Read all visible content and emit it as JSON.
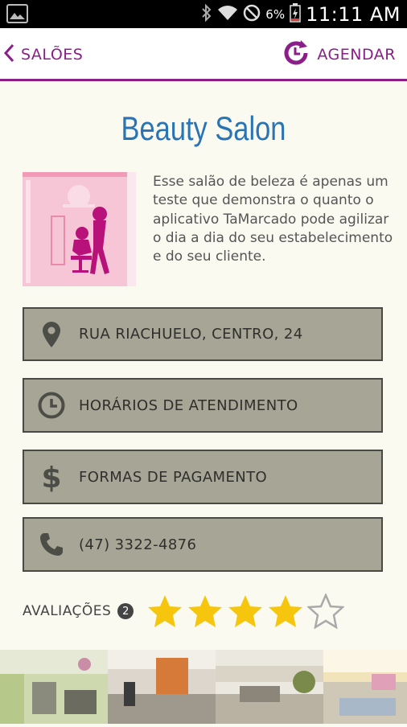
{
  "status_bar": {
    "battery_percent": "6%",
    "time": "11:11 AM"
  },
  "action_bar": {
    "back_label": "SALÕES",
    "agendar_label": "AGENDAR",
    "accent_color": "#8a1f8a"
  },
  "salon": {
    "name": "Beauty Salon",
    "description": "Esse salão de beleza é apenas um teste que demonstra o quanto o aplicativo TaMarcado pode agilizar o dia a dia do seu estabelecimento e do seu cliente."
  },
  "info": {
    "address": "RUA RIACHUELO, CENTRO, 24",
    "hours": "HORÁRIOS DE ATENDIMENTO",
    "payment": "FORMAS DE PAGAMENTO",
    "phone": "(47) 3322-4876"
  },
  "ratings": {
    "label": "AVALIAÇÕES",
    "count": "2",
    "stars_filled": 4,
    "stars_total": 5,
    "star_color": "#f6c60f"
  }
}
